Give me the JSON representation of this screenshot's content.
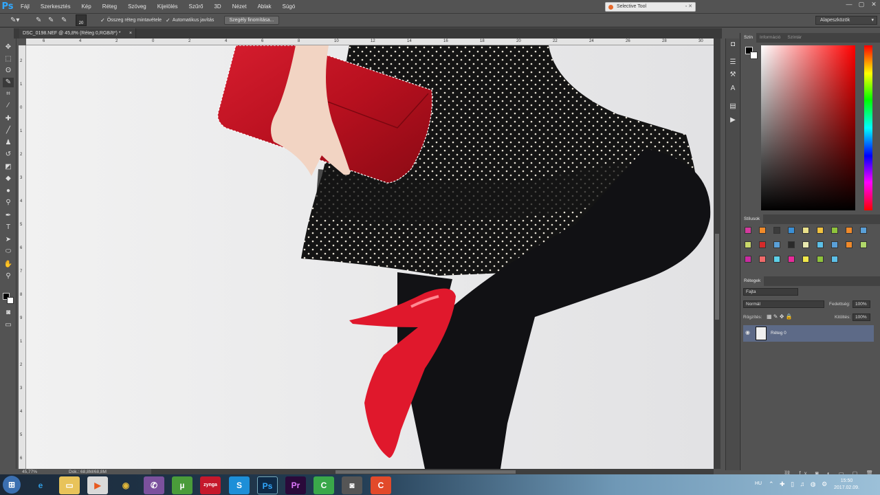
{
  "app": {
    "logo": "Ps"
  },
  "menu": [
    "Fájl",
    "Szerkesztés",
    "Kép",
    "Réteg",
    "Szöveg",
    "Kijelölés",
    "Szűrő",
    "3D",
    "Nézet",
    "Ablak",
    "Súgó"
  ],
  "floating_window": {
    "title": "Selective Tool"
  },
  "options": {
    "brush_size": "20",
    "sample_all_layers_label": "Összeg réteg mintavétele",
    "auto_enhance_label": "Automatikus javítás",
    "refine_edge_label": "Szegély finomítása...",
    "workspace": "Alapeszközök"
  },
  "document": {
    "tab_title": "DSC_0198.NEF @ 45,8% (Réteg 0,RGB/8*) *"
  },
  "ruler": {
    "top": [
      "6",
      "4",
      "2",
      "0",
      "2",
      "4",
      "6",
      "8",
      "10",
      "12",
      "14",
      "16",
      "18",
      "20",
      "22",
      "24",
      "26",
      "28",
      "30"
    ],
    "left": [
      "2",
      "1",
      "0",
      "1",
      "2",
      "3",
      "4",
      "5",
      "6",
      "7",
      "8",
      "9",
      "1",
      "2",
      "3",
      "4",
      "5",
      "6"
    ]
  },
  "status": {
    "zoom": "45,77%",
    "doc": "Dok.: 68,8M/68,8M"
  },
  "panels": {
    "color_tabs": [
      "Szín",
      "Információ",
      "Színtár"
    ],
    "styles_title": "Stílusok",
    "layers_title": "Rétegek",
    "kind_filter": "Fajta",
    "blend_mode": "Normál",
    "opacity_label": "Fedettség:",
    "opacity_value": "100%",
    "lock_label": "Rögzítés:",
    "fill_label": "Kitöltés:",
    "fill_value": "100%",
    "layer_name": "Réteg 0"
  },
  "swatch_colors": [
    "#d43a9d",
    "#f08a2a",
    "#3c3c3c",
    "#3a8fd6",
    "#e9e08a",
    "#f1c23e",
    "#8fc33c",
    "#f08a2a",
    "#5aa0d8",
    "#c9d86a",
    "#d62a2a",
    "#5aa0d8",
    "#2a2a2a",
    "#e9e9b0",
    "#5cc0e8",
    "#5aa0d8",
    "#f08a2a",
    "#b0d86a",
    "#c92aa0",
    "#f06a6a",
    "#5cd0e8",
    "#e82a9a",
    "#f2e84a",
    "#8fc33c",
    "#5cc0e8"
  ],
  "taskbar": {
    "language": "HU",
    "time": "15:50",
    "date": "2017.02.09."
  }
}
